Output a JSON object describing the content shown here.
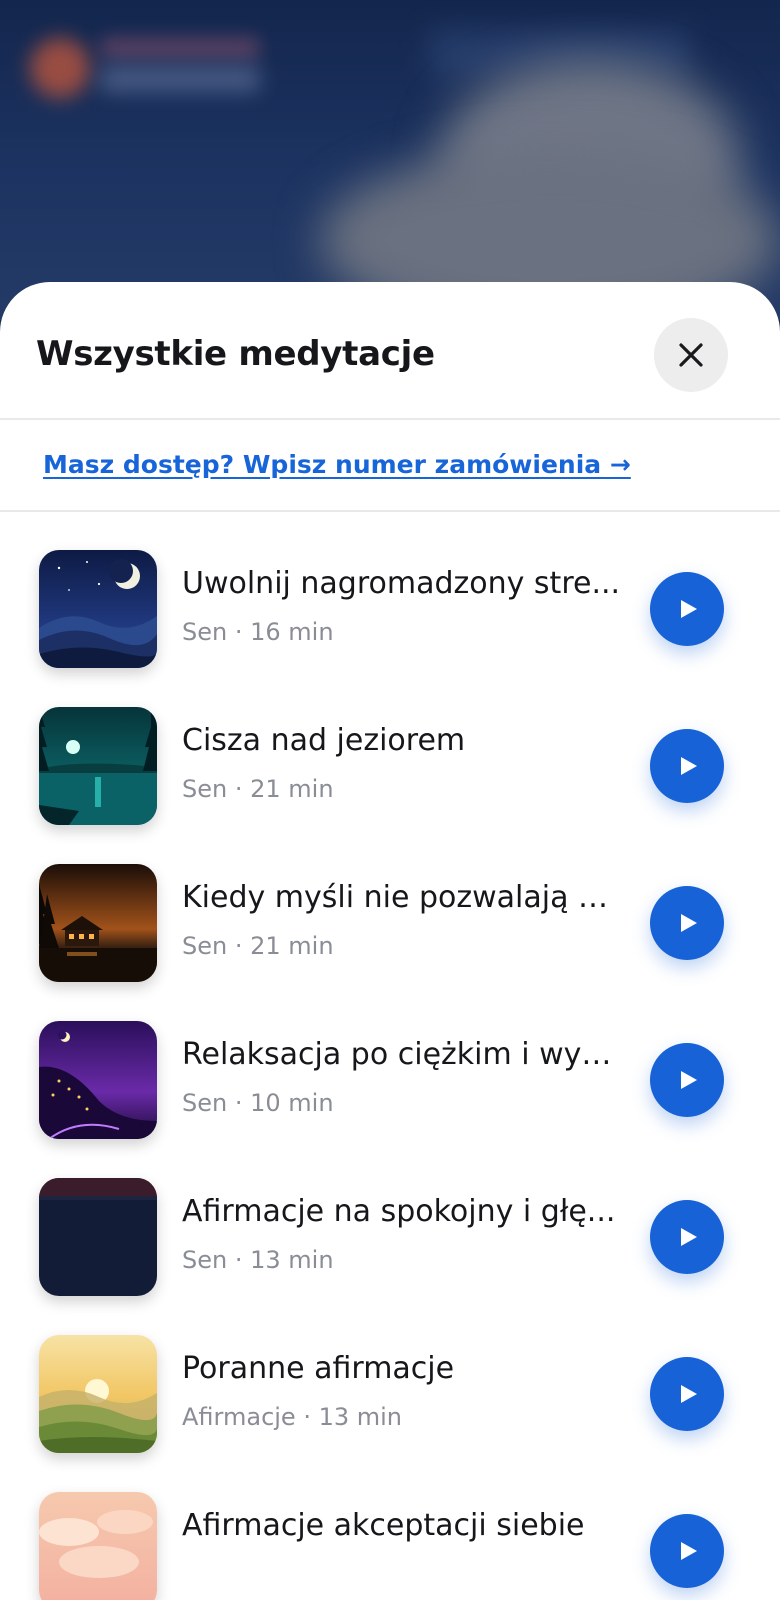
{
  "sheet": {
    "title": "Wszystkie medytacje",
    "access_link": "Masz dostęp? Wpisz numer zamówienia →",
    "close_icon": "close-icon"
  },
  "colors": {
    "accent": "#1762d6",
    "link": "#1765d8",
    "title_text": "#16171b",
    "meta_text": "#8a8d96"
  },
  "meditations": [
    {
      "title": "Uwolnij nagromadzony stre...",
      "meta": "Sen · 16 min",
      "icon": "play-icon"
    },
    {
      "title": "Cisza nad jeziorem",
      "meta": "Sen · 21 min",
      "icon": "play-icon"
    },
    {
      "title": "Kiedy myśli nie pozwalają Ci...",
      "meta": "Sen · 21 min",
      "icon": "play-icon"
    },
    {
      "title": "Relaksacja po ciężkim i wyc...",
      "meta": "Sen · 10 min",
      "icon": "play-icon"
    },
    {
      "title": "Afirmacje na spokojny i głę...",
      "meta": "Sen · 13 min",
      "icon": "play-icon"
    },
    {
      "title": "Poranne afirmacje",
      "meta": "Afirmacje · 13 min",
      "icon": "play-icon"
    },
    {
      "title": "Afirmacje akceptacji siebie",
      "meta": "",
      "icon": "play-icon"
    }
  ]
}
